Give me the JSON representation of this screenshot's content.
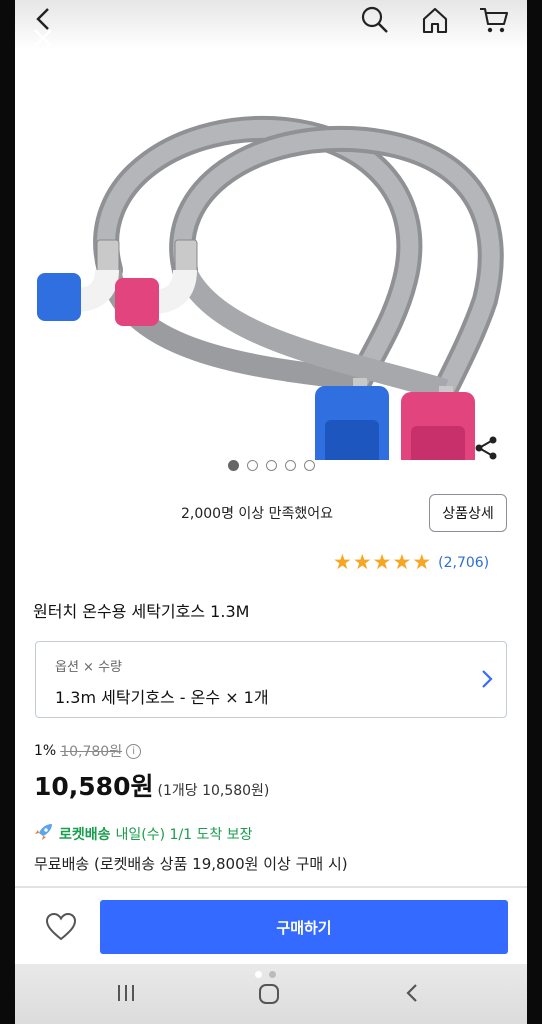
{
  "header": {
    "back_icon": "chevron-left-icon",
    "close_icon": "close-icon",
    "search_icon": "search-icon",
    "home_icon": "home-icon",
    "cart_icon": "cart-icon"
  },
  "gallery": {
    "image_alt": "gray washing machine hoses with blue and pink faucet connectors",
    "page_count": 5,
    "active_page": 1,
    "share_icon": "share-icon"
  },
  "satisfaction": {
    "text": "2,000명 이상 만족했어요",
    "detail_button": "상품상세"
  },
  "rating": {
    "stars": 5,
    "review_count": "(2,706)"
  },
  "product": {
    "title": "원터치 온수용 세탁기호스 1.3M"
  },
  "option": {
    "label": "옵션 × 수량",
    "value": "1.3m 세탁기호스 - 온수 × 1개"
  },
  "price": {
    "discount": "1%",
    "original": "10,780원",
    "sale": "10,580원",
    "unit": "(1개당 10,580원)"
  },
  "delivery": {
    "rocket_label": "로켓배송",
    "date_text": "내일(수) 1/1 도착 보장",
    "shipping_text": "무료배송 (로켓배송 상품 19,800원 이상 구매 시)"
  },
  "buybar": {
    "buy_label": "구매하기",
    "wishlist_icon": "heart-icon"
  },
  "colors": {
    "accent_blue": "#346aff",
    "rocket_green": "#1a9e4d",
    "star": "#f5a623",
    "review_link": "#2e6ed6"
  }
}
